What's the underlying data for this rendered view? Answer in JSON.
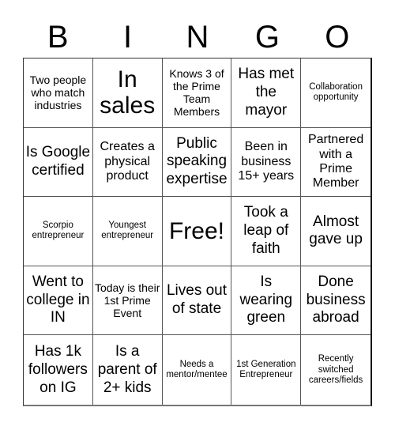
{
  "title_letters": [
    "B",
    "I",
    "N",
    "G",
    "O"
  ],
  "cells": [
    {
      "text": "Two people who match industries",
      "size": "s"
    },
    {
      "text": "In sales",
      "size": "xl"
    },
    {
      "text": "Knows 3 of the Prime Team Members",
      "size": "s"
    },
    {
      "text": "Has met the mayor",
      "size": "l"
    },
    {
      "text": "Collaboration opportunity",
      "size": "xs"
    },
    {
      "text": "Is Google certified",
      "size": "l"
    },
    {
      "text": "Creates a physical product",
      "size": "m"
    },
    {
      "text": "Public speaking expertise",
      "size": "l"
    },
    {
      "text": "Been in business 15+ years",
      "size": "m"
    },
    {
      "text": "Partnered with a Prime Member",
      "size": "m"
    },
    {
      "text": "Scorpio entrepreneur",
      "size": "xs"
    },
    {
      "text": "Youngest entrepreneur",
      "size": "xs"
    },
    {
      "text": "Free!",
      "size": "xl",
      "free": true
    },
    {
      "text": "Took a leap of faith",
      "size": "l"
    },
    {
      "text": "Almost gave up",
      "size": "l"
    },
    {
      "text": "Went to college in IN",
      "size": "l"
    },
    {
      "text": "Today is their 1st Prime Event",
      "size": "s"
    },
    {
      "text": "Lives out of state",
      "size": "l"
    },
    {
      "text": "Is wearing green",
      "size": "l"
    },
    {
      "text": "Done business abroad",
      "size": "l"
    },
    {
      "text": "Has 1k followers on IG",
      "size": "l"
    },
    {
      "text": "Is a parent of 2+ kids",
      "size": "l"
    },
    {
      "text": "Needs a mentor/mentee",
      "size": "xs"
    },
    {
      "text": "1st Generation Entrepreneur",
      "size": "xs"
    },
    {
      "text": "Recently switched careers/fields",
      "size": "xs"
    }
  ]
}
